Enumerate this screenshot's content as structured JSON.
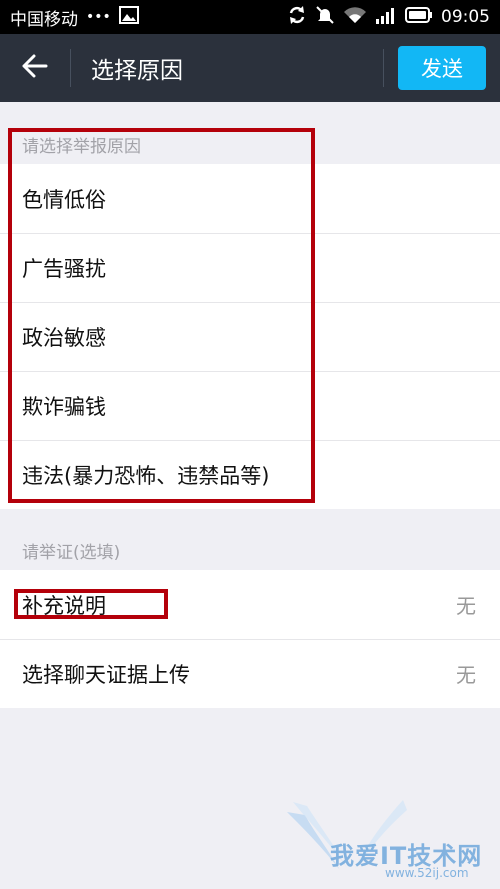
{
  "status_bar": {
    "carrier": "中国移动",
    "dots": "•••",
    "time": "09:05"
  },
  "header": {
    "title": "选择原因",
    "send_label": "发送"
  },
  "reason_section": {
    "label": "请选择举报原因",
    "items": [
      {
        "label": "色情低俗"
      },
      {
        "label": "广告骚扰"
      },
      {
        "label": "政治敏感"
      },
      {
        "label": "欺诈骗钱"
      },
      {
        "label": "违法(暴力恐怖、违禁品等)"
      }
    ]
  },
  "evidence_section": {
    "label": "请举证(选填)",
    "items": [
      {
        "label": "补充说明",
        "value": "无"
      },
      {
        "label": "选择聊天证据上传",
        "value": "无"
      }
    ]
  },
  "watermark": {
    "text": "我爱IT技术网",
    "url": "www.52ij.com"
  },
  "colors": {
    "header_bg": "#2b313c",
    "send_bg": "#12b7f5",
    "annotation_red": "#b4000a",
    "page_bg": "#efeff4"
  }
}
